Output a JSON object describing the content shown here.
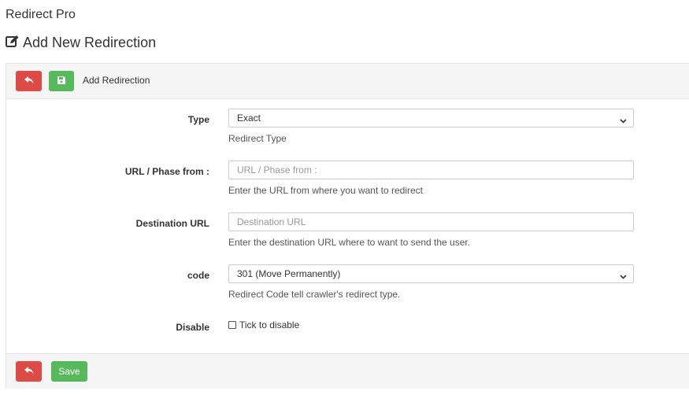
{
  "app": {
    "title": "Redirect Pro"
  },
  "page": {
    "title": "Add New Redirection",
    "icon": "edit-icon"
  },
  "panel_head": {
    "title": "Add Redirection",
    "back_icon": "reply-icon",
    "save_icon": "floppy-disk-icon"
  },
  "form": {
    "type": {
      "label": "Type",
      "value": "Exact",
      "help": "Redirect Type"
    },
    "url_from": {
      "label": "URL / Phase from :",
      "placeholder": "URL / Phase from :",
      "help": "Enter the URL from where you want to redirect"
    },
    "destination": {
      "label": "Destination URL",
      "placeholder": "Destination URL",
      "help": "Enter the destination URL where to want to send the user."
    },
    "code": {
      "label": "code",
      "value": "301 (Move Permanently)",
      "help": "Redirect Code tell crawler's redirect type."
    },
    "disable": {
      "label": "Disable",
      "checkbox_label": "Tick to disable"
    }
  },
  "footer": {
    "save_label": "Save"
  },
  "colors": {
    "danger": "#dd4b47",
    "success": "#58b95c",
    "panel_bg": "#f5f5f5"
  }
}
